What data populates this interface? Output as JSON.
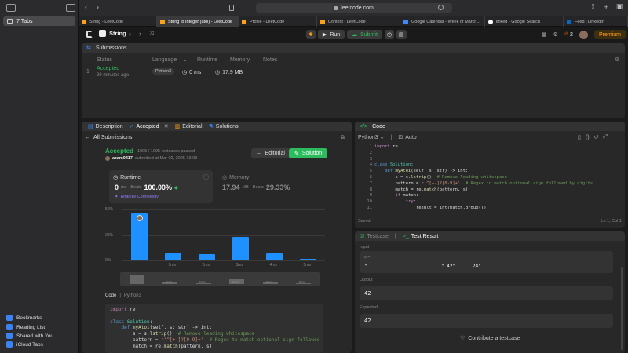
{
  "sidebar": {
    "tabs_label": "7 Tabs",
    "footer": [
      "Bookmarks",
      "Reading List",
      "Shared with You",
      "iCloud Tabs"
    ]
  },
  "browser": {
    "url": "leetcode.com",
    "tabs": [
      {
        "label": "String - LeetCode"
      },
      {
        "label": "String to Integer (atoi) - LeetCode"
      },
      {
        "label": "Profile - LeetCode"
      },
      {
        "label": "Contest - LeetCode"
      },
      {
        "label": "Google Calendar - Week of March..."
      },
      {
        "label": "linked - Google Search"
      },
      {
        "label": "Feed | LinkedIn"
      }
    ]
  },
  "lc_header": {
    "problem_list": "String",
    "run": "Run",
    "submit": "Submit",
    "streak": "2",
    "premium": "Premium"
  },
  "submissions_panel": {
    "title": "Submissions",
    "columns": [
      "Status",
      "Language",
      "Runtime",
      "Memory",
      "Notes"
    ],
    "row": {
      "index": "1",
      "status": "Accepted",
      "time_ago": "39 minutes ago",
      "language": "Python3",
      "runtime": "0 ms",
      "memory": "17.9 MB"
    }
  },
  "left_panel": {
    "tabs": [
      "Description",
      "Accepted",
      "Editorial",
      "Solutions"
    ],
    "back": "All Submissions",
    "status": "Accepted",
    "testcases": "1095 / 1095 testcases passed",
    "user": "azam0417",
    "submitted_at": "submitted at Mar 02, 2025 13:08",
    "editorial_btn": "Editorial",
    "solution_btn": "Solution",
    "runtime_title": "Runtime",
    "runtime_value": "0",
    "runtime_unit": "ms",
    "beats_label": "Beats",
    "runtime_beats": "100.00%",
    "analyze": "Analyze Complexity",
    "memory_title": "Memory",
    "memory_value": "17.94",
    "memory_unit": "MB",
    "memory_beats": "29.33%",
    "code_label": "Code",
    "code_lang": "Python3"
  },
  "chart_data": {
    "type": "bar",
    "yticks": [
      "50%",
      "25%",
      "0%"
    ],
    "categories": [
      "",
      "1ms",
      "2ms",
      "3ms",
      "4ms",
      "5ms"
    ],
    "values": [
      46,
      7,
      6,
      23,
      7,
      1.5
    ],
    "ylim": [
      0,
      50
    ],
    "highlight_index": 0
  },
  "code_panel": {
    "title": "Code",
    "language": "Python3",
    "mode": "Auto",
    "saved": "Saved",
    "position": "Ln 1, Col 1"
  },
  "test_panel": {
    "tab_testcase": "Testcase",
    "tab_result": "Test Result",
    "input_label": "Input",
    "input_var": "s =",
    "input_value": "\"   42\"",
    "input_value2": "24\"",
    "output_label": "Output",
    "output_value": "42",
    "expected_label": "Expected",
    "expected_value": "42",
    "contribute": "Contribute a testcase"
  }
}
